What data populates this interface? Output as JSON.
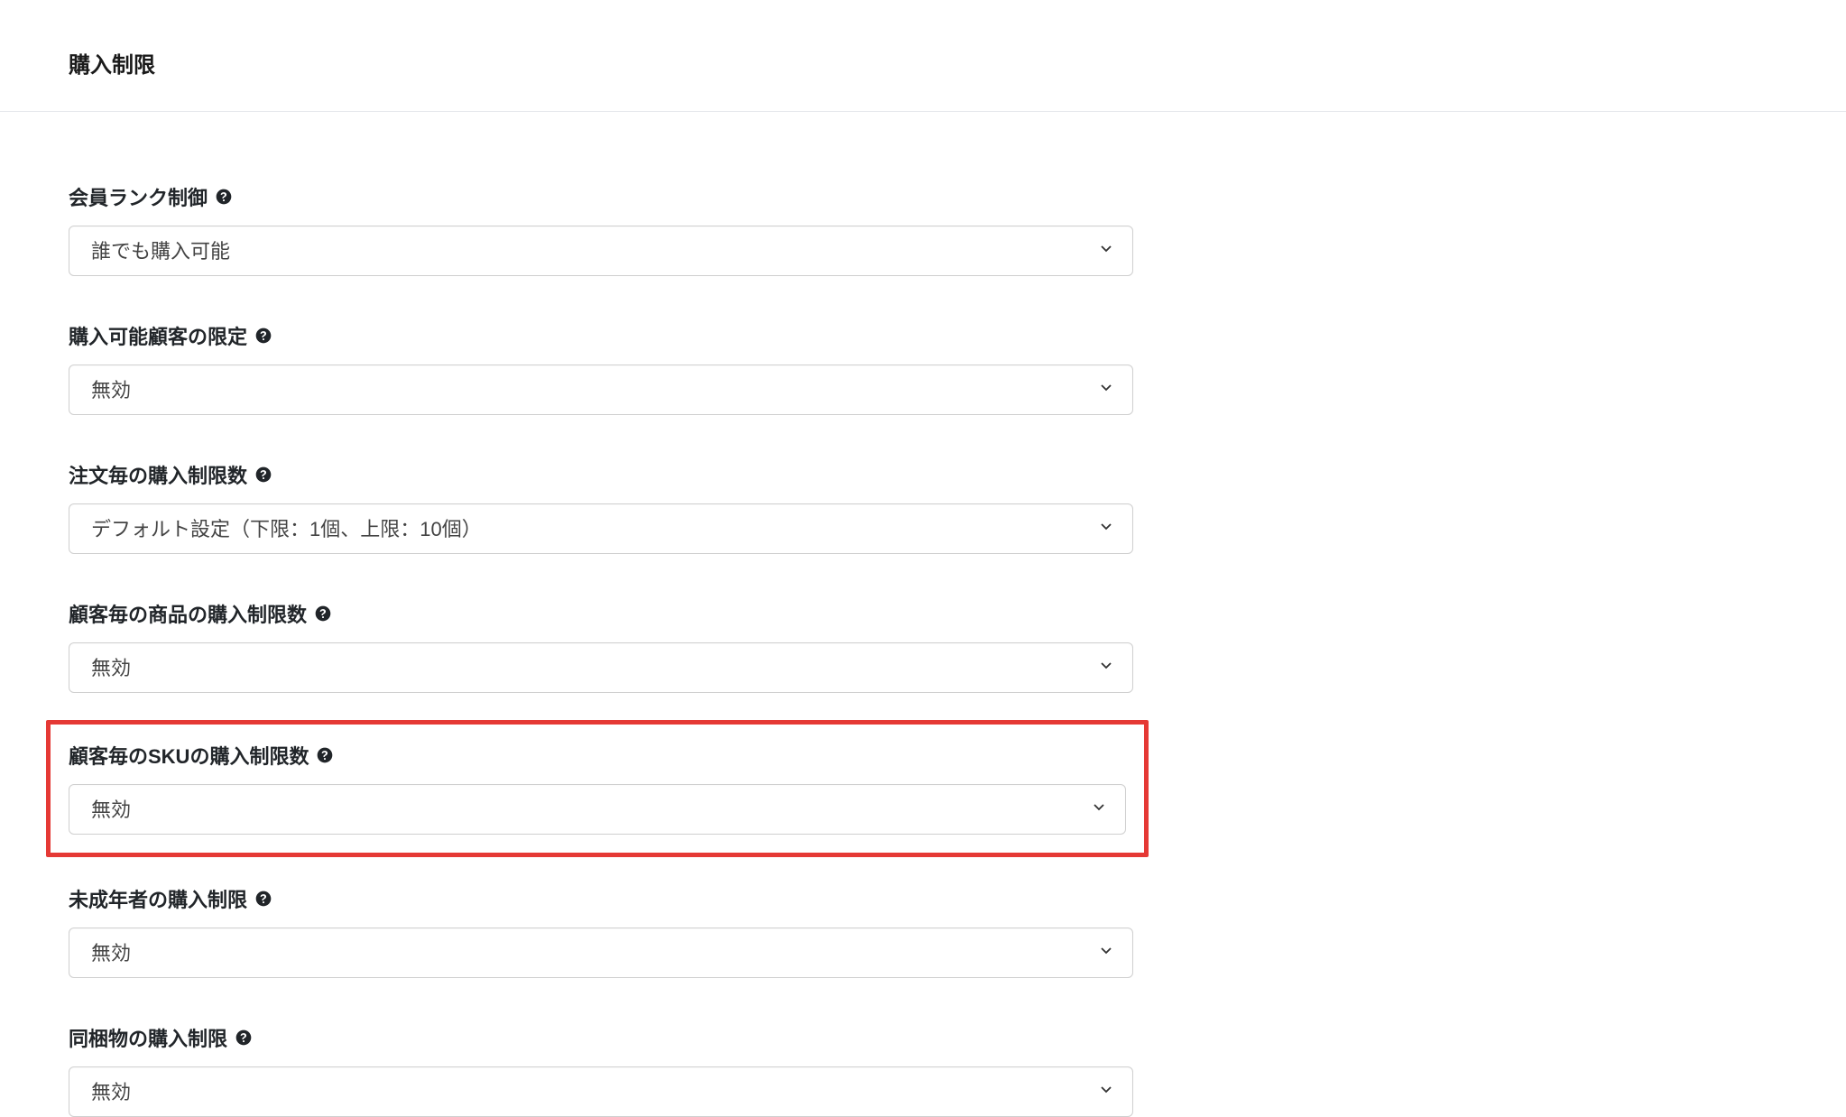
{
  "section": {
    "title": "購入制限"
  },
  "fields": {
    "member_rank": {
      "label": "会員ランク制御",
      "value": "誰でも購入可能"
    },
    "eligible_customer": {
      "label": "購入可能顧客の限定",
      "value": "無効"
    },
    "per_order_limit": {
      "label": "注文毎の購入制限数",
      "value": "デフォルト設定（下限：1個、上限：10個）"
    },
    "per_customer_product_limit": {
      "label": "顧客毎の商品の購入制限数",
      "value": "無効"
    },
    "per_customer_sku_limit": {
      "label": "顧客毎のSKUの購入制限数",
      "value": "無効"
    },
    "minor_restriction": {
      "label": "未成年者の購入制限",
      "value": "無効"
    },
    "bundled_restriction": {
      "label": "同梱物の購入制限",
      "value": "無効"
    }
  }
}
